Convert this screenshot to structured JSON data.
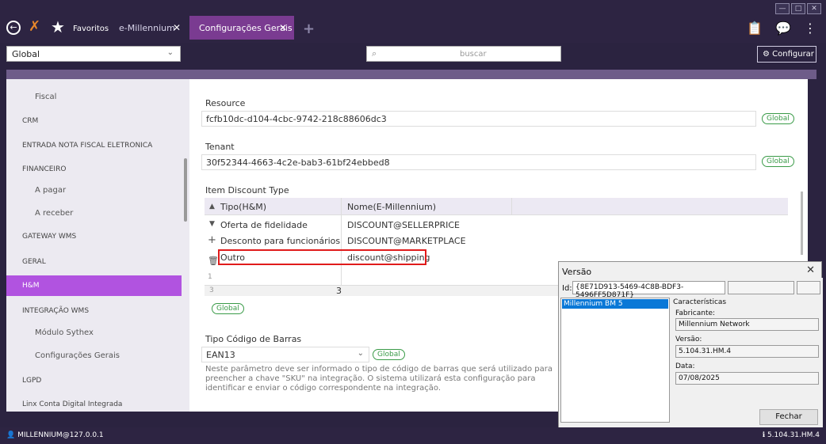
{
  "window_controls": {
    "minimize": "—",
    "restore": "□",
    "close": "✕"
  },
  "topbar": {
    "favorites_label": "Favoritos",
    "tabs": [
      {
        "label": "e-Millennium",
        "close": "✕"
      },
      {
        "label": "Configurações Gerais",
        "close": "✕"
      }
    ],
    "add_tab": "+",
    "icons": [
      "clipboard-icon",
      "chat-icon",
      "more-icon"
    ]
  },
  "filter": {
    "scope_value": "Global",
    "search_placeholder": "buscar",
    "configure_label": "⚙ Configurar"
  },
  "sidebar": {
    "items": [
      {
        "label": "Fiscal",
        "type": "sub"
      },
      {
        "label": "CRM",
        "type": "section"
      },
      {
        "label": "ENTRADA NOTA FISCAL ELETRONICA",
        "type": "section"
      },
      {
        "label": "FINANCEIRO",
        "type": "section"
      },
      {
        "label": "A pagar",
        "type": "sub"
      },
      {
        "label": "A receber",
        "type": "sub"
      },
      {
        "label": "GATEWAY WMS",
        "type": "section"
      },
      {
        "label": "GERAL",
        "type": "section"
      },
      {
        "label": "H&M",
        "type": "section",
        "active": true
      },
      {
        "label": "INTEGRAÇÃO WMS",
        "type": "section"
      },
      {
        "label": "Módulo Sythex",
        "type": "sub"
      },
      {
        "label": "Configurações Gerais",
        "type": "sub"
      },
      {
        "label": "LGPD",
        "type": "section"
      },
      {
        "label": "Linx Conta Digital Integrada",
        "type": "section"
      }
    ]
  },
  "main": {
    "resource": {
      "label": "Resource",
      "value": "fcfb10dc-d104-4cbc-9742-218c88606dc3",
      "badge": "Global"
    },
    "tenant": {
      "label": "Tenant",
      "value": "30f52344-4663-4c2e-bab3-61bf24ebbed8",
      "badge": "Global"
    },
    "discount": {
      "label": "Item Discount Type",
      "columns": [
        "Tipo(H&M)",
        "Nome(E-Millennium)"
      ],
      "rows": [
        {
          "tipo": "Oferta de fidelidade",
          "nome": "DISCOUNT@SELLERPRICE"
        },
        {
          "tipo": "Desconto para funcionários",
          "nome": "DISCOUNT@MARKETPLACE"
        },
        {
          "tipo": "Outro",
          "nome": "discount@shipping"
        }
      ],
      "row_numbers": [
        "1",
        "3"
      ],
      "footer_count": "3",
      "badge": "Global"
    },
    "barcode": {
      "label": "Tipo Código de Barras",
      "value": "EAN13",
      "badge": "Global",
      "note": "Neste parâmetro deve ser informado o tipo de código de barras que será utilizado para preencher a chave \"SKU\" na integração. O sistema utilizará esta configuração para identificar e enviar o código correspondente na integração."
    }
  },
  "dialog": {
    "title": "Versão",
    "close": "✕",
    "id_label": "Id:",
    "id_value": "{8E71D913-5469-4C8B-BDF3-5496FF5D871F}",
    "list_items": [
      "Millennium BM 5"
    ],
    "characteristics": "Características",
    "fabricante_label": "Fabricante:",
    "fabricante": "Millennium Network",
    "versao_label": "Versão:",
    "versao": "5.104.31.HM.4",
    "data_label": "Data:",
    "data": "07/08/2025",
    "button": "Fechar"
  },
  "status": {
    "user": "MILLENNIUM@127.0.0.1",
    "version": "5.104.31.HM.4"
  }
}
